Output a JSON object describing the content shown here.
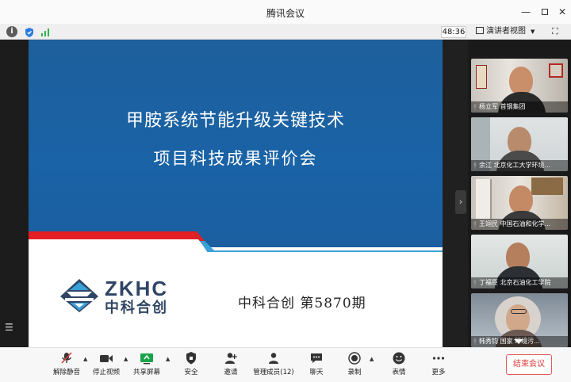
{
  "window": {
    "title": "腾讯会议"
  },
  "infobar": {
    "timer": "48:36",
    "view_mode": "演讲者视图"
  },
  "slide": {
    "title_line1": "甲胺系统节能升级关键技术",
    "title_line2": "项目科技成果评价会",
    "logo_en": "ZKHC",
    "logo_cn": "中科合创",
    "issue": "中科合创  第5870期"
  },
  "participants": [
    {
      "name": "杨立军 首钢集团"
    },
    {
      "name": "余江 北京化工大学环境..."
    },
    {
      "name": "王翊民 中国石油和化学..."
    },
    {
      "name": "丁福臣 北京石油化工学院"
    },
    {
      "name": "韩秀钧 国家      环境污..."
    }
  ],
  "toolbar": {
    "unmute": "解除静音",
    "stop_video": "停止视频",
    "share_screen": "共享屏幕",
    "security": "安全",
    "invite": "邀请",
    "manage_members": "管理成员(12)",
    "chat": "聊天",
    "record": "录制",
    "emoji": "表情",
    "more": "更多",
    "end_meeting": "结束会议"
  },
  "colors": {
    "slide_blue": "#1b61a3",
    "stripe_red": "#e31e24",
    "stripe_blue": "#3aa0d8",
    "logo_navy": "#2f4563",
    "end_red": "#e03b3b",
    "share_green": "#17a34a"
  }
}
